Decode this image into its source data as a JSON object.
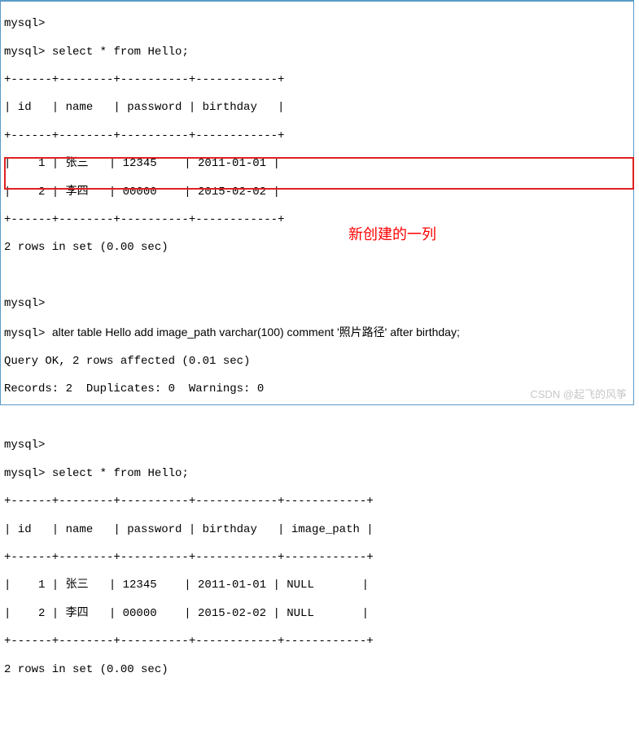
{
  "prompt": "mysql>",
  "stmt_select": "select * from Hello;",
  "stmt_alter": "alter table Hello add image_path varchar(100) comment '照片路径' after birthday;",
  "result1": {
    "sep": "+------+--------+----------+------------+",
    "head": "| id   | name   | password | birthday   |",
    "rows": [
      "|    1 | 张三   | 12345    | 2011-01-01 |",
      "|    2 | 李四   | 00000    | 2015-02-02 |"
    ],
    "summary": "2 rows in set (0.00 sec)"
  },
  "alter_result": {
    "query_ok": "Query OK, 2 rows affected (0.01 sec)",
    "records": "Records: 2  Duplicates: 0  Warnings: 0"
  },
  "result2": {
    "sep": "+------+--------+----------+------------+------------+",
    "head": "| id   | name   | password | birthday   | image_path |",
    "rows": [
      "|    1 | 张三   | 12345    | 2011-01-01 | NULL       |",
      "|    2 | 李四   | 00000    | 2015-02-02 | NULL       |"
    ],
    "summary": "2 rows in set (0.00 sec)"
  },
  "annotation": "新创建的一列",
  "watermark": "CSDN @起飞的风筝",
  "chart_data": {
    "type": "table",
    "tables": [
      {
        "name": "Hello (before alter)",
        "columns": [
          "id",
          "name",
          "password",
          "birthday"
        ],
        "rows": [
          [
            1,
            "张三",
            "12345",
            "2011-01-01"
          ],
          [
            2,
            "李四",
            "00000",
            "2015-02-02"
          ]
        ]
      },
      {
        "name": "Hello (after alter)",
        "columns": [
          "id",
          "name",
          "password",
          "birthday",
          "image_path"
        ],
        "rows": [
          [
            1,
            "张三",
            "12345",
            "2011-01-01",
            null
          ],
          [
            2,
            "李四",
            "00000",
            "2015-02-02",
            null
          ]
        ]
      }
    ]
  }
}
